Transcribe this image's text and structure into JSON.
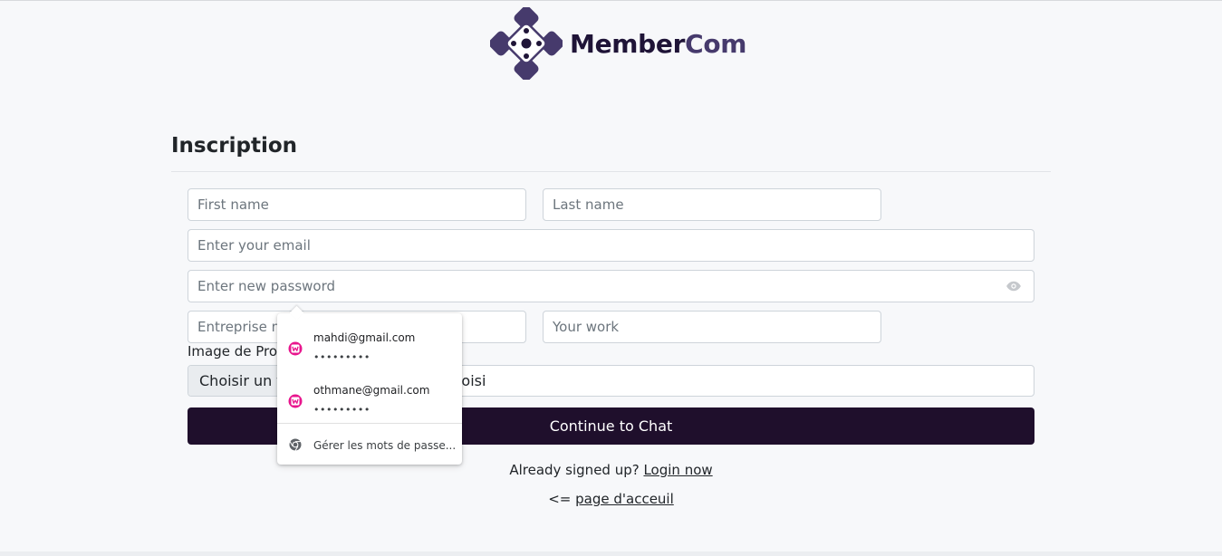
{
  "brand": {
    "name_part1": "Member",
    "name_part2": "Com",
    "color_dark": "#1f1437",
    "color_mid": "#463a6c"
  },
  "form": {
    "title": "Inscription",
    "first_name_placeholder": "First name",
    "last_name_placeholder": "Last name",
    "email_placeholder": "Enter your email",
    "password_placeholder": "Enter new password",
    "password_toggle_icon": "eye-icon",
    "enterprise_placeholder": "Entreprise name",
    "work_placeholder": "Your work",
    "image_label": "Image de Profil",
    "file_button_label": "Choisir un fichier",
    "file_status": "Aucun fichier choisi",
    "submit_label": "Continue to Chat",
    "submit_color": "#1f0f2c"
  },
  "footer": {
    "already_text": "Already signed up? ",
    "login_link": "Login now",
    "home_prefix": "<= ",
    "home_link": "page d'acceuil"
  },
  "autofill": {
    "accounts": [
      {
        "email": "mahdi@gmail.com",
        "password_mask": "•••••••••",
        "icon": "site-key-icon"
      },
      {
        "email": "othmane@gmail.com",
        "password_mask": "•••••••••",
        "icon": "site-key-icon"
      }
    ],
    "manage_label": "Gérer les mots de passe...",
    "manage_icon": "chrome-icon",
    "accent_color": "#e8158d"
  }
}
